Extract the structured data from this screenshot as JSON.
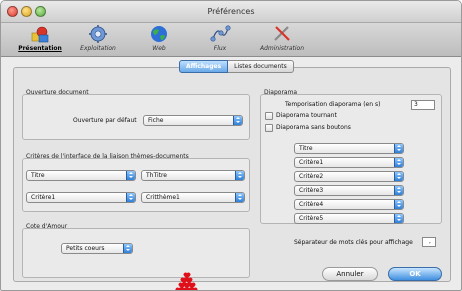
{
  "window": {
    "title": "Préférences"
  },
  "toolbar": {
    "items": [
      {
        "label": "Présentation",
        "icon": "presentation-icon",
        "active": true
      },
      {
        "label": "Exploitation",
        "icon": "exploitation-icon",
        "active": false
      },
      {
        "label": "Web",
        "icon": "globe-icon",
        "active": false
      },
      {
        "label": "Flux",
        "icon": "flux-icon",
        "active": false
      },
      {
        "label": "Administration",
        "icon": "administration-icon",
        "active": false
      }
    ]
  },
  "tabs": [
    {
      "label": "Affichages",
      "selected": true
    },
    {
      "label": "Listes documents",
      "selected": false
    }
  ],
  "ouverture": {
    "title": "Ouverture document",
    "label": "Ouverture par défaut",
    "value": "Fiche"
  },
  "criteres": {
    "title": "Critères de l'interface de la liaison thèmes-documents",
    "popups": [
      "Titre",
      "ThTitre",
      "Critère1",
      "Critthème1"
    ]
  },
  "cote": {
    "title": "Cote d'Amour",
    "value": "Petits coeurs"
  },
  "diaporama": {
    "title": "Diaporama",
    "temporisation_label": "Temporisation diaporama (en s)",
    "temporisation_value": "3",
    "tournant_label": "Diaporama tournant",
    "tournant_checked": false,
    "sans_boutons_label": "Diaporama sans boutons",
    "sans_boutons_checked": false,
    "popups": [
      "Titre",
      "Critère1",
      "Critère2",
      "Critère3",
      "Critère4",
      "Critère5"
    ]
  },
  "separateur": {
    "label": "Séparateur de mots clés pour affichage",
    "value": ","
  },
  "buttons": {
    "cancel": "Annuler",
    "ok": "OK"
  },
  "colors": {
    "accent": "#3f8fe0",
    "heart": "#e0101a"
  }
}
